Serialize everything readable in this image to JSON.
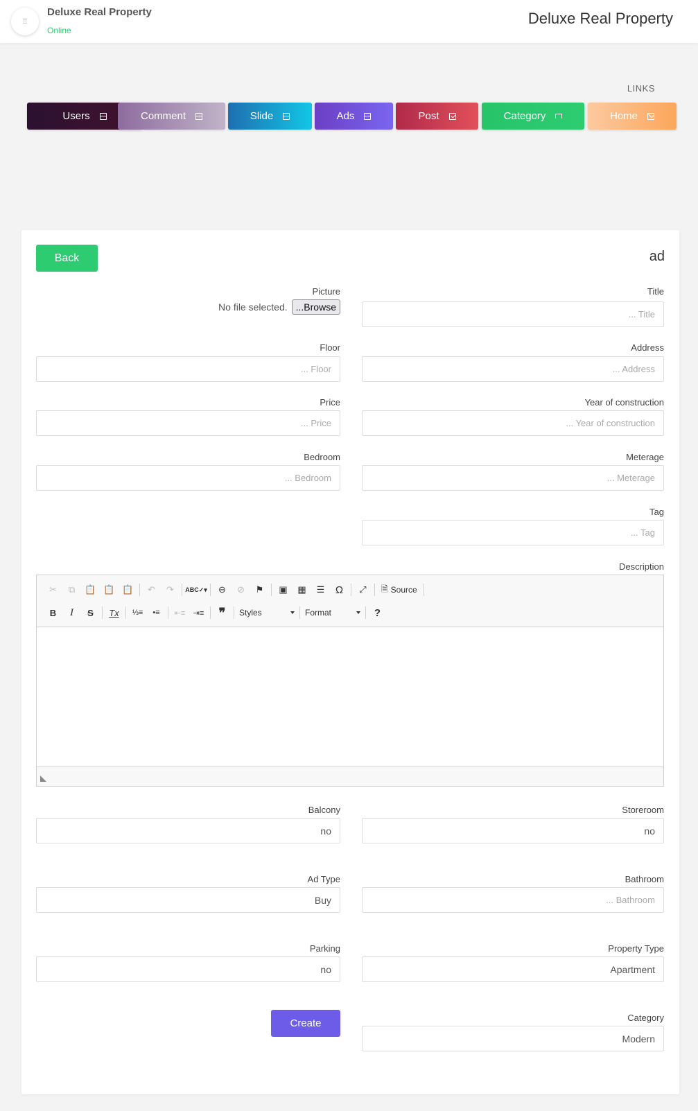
{
  "header": {
    "avatar_glyph": "♖",
    "brand_name": "Deluxe Real Property",
    "status": "Online",
    "title": "Deluxe Real Property"
  },
  "links": {
    "label": "LINKS",
    "items": [
      {
        "label": "Users",
        "icon": "calendar-icon",
        "gradient": [
          "#2b1130",
          "#42122e"
        ]
      },
      {
        "label": "Comment",
        "icon": "calendar-icon",
        "gradient": [
          "#8e6c9e",
          "#c0b3c8"
        ]
      },
      {
        "label": "Slide",
        "icon": "calendar-icon",
        "gradient": [
          "#1e6fb0",
          "#12c6e6"
        ]
      },
      {
        "label": "Ads",
        "icon": "calendar-icon",
        "gradient": [
          "#6b3fc4",
          "#7a66f0"
        ]
      },
      {
        "label": "Post",
        "icon": "check-square-icon",
        "gradient": [
          "#b02a4a",
          "#e2505a"
        ]
      },
      {
        "label": "Category",
        "icon": "flag-icon",
        "gradient": [
          "#27c46a",
          "#2ecc71"
        ]
      },
      {
        "label": "Home",
        "icon": "mail-icon",
        "gradient": [
          "#fdc9a0",
          "#fba65a"
        ]
      }
    ]
  },
  "form": {
    "back_label": "Back",
    "title": "ad",
    "picture": {
      "label": "Picture",
      "status": "No file selected.",
      "browse_label": "...Browse"
    },
    "title_field": {
      "label": "Title",
      "placeholder": "... Title"
    },
    "floor": {
      "label": "Floor",
      "placeholder": "... Floor"
    },
    "address": {
      "label": "Address",
      "placeholder": "... Address"
    },
    "price": {
      "label": "Price",
      "placeholder": "... Price"
    },
    "year": {
      "label": "Year of construction",
      "placeholder": "... Year of construction"
    },
    "bedroom": {
      "label": "Bedroom",
      "placeholder": "... Bedroom"
    },
    "meterage": {
      "label": "Meterage",
      "placeholder": "... Meterage"
    },
    "tag": {
      "label": "Tag",
      "placeholder": "... Tag"
    },
    "description": {
      "label": "Description",
      "source_label": "Source",
      "styles_label": "Styles",
      "format_label": "Format",
      "help_label": "?"
    },
    "balcony": {
      "label": "Balcony",
      "value": "no"
    },
    "storeroom": {
      "label": "Storeroom",
      "value": "no"
    },
    "ad_type": {
      "label": "Ad Type",
      "value": "Buy"
    },
    "bathroom": {
      "label": "Bathroom",
      "placeholder": "... Bathroom"
    },
    "parking": {
      "label": "Parking",
      "value": "no"
    },
    "property_type": {
      "label": "Property Type",
      "value": "Apartment"
    },
    "category": {
      "label": "Category",
      "value": "Modern"
    },
    "create_label": "Create"
  },
  "colors": {
    "accent_green": "#2ecc71",
    "create_purple": "#6c5ce7"
  }
}
